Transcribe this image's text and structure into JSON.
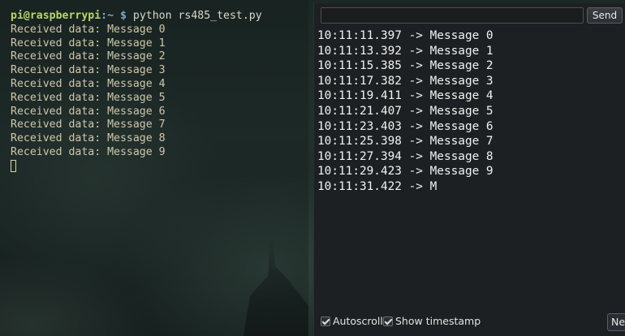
{
  "terminal": {
    "prompt_user": "pi@raspberrypi",
    "prompt_path": ":~ $",
    "command": "python rs485_test.py",
    "lines": [
      "Received data: Message 0",
      "Received data: Message 1",
      "Received data: Message 2",
      "Received data: Message 3",
      "Received data: Message 4",
      "Received data: Message 5",
      "Received data: Message 6",
      "Received data: Message 7",
      "Received data: Message 8",
      "Received data: Message 9"
    ]
  },
  "serial_monitor": {
    "input_value": "",
    "send_label": "Send",
    "output_lines": [
      "10:11:11.397 -> Message 0",
      "10:11:13.392 -> Message 1",
      "10:11:15.385 -> Message 2",
      "10:11:17.382 -> Message 3",
      "10:11:19.411 -> Message 4",
      "10:11:21.407 -> Message 5",
      "10:11:23.403 -> Message 6",
      "10:11:25.398 -> Message 7",
      "10:11:27.394 -> Message 8",
      "10:11:29.423 -> Message 9",
      "10:11:31.422 -> M"
    ],
    "autoscroll_label": "Autoscroll",
    "autoscroll_checked": true,
    "timestamp_label": "Show timestamp",
    "timestamp_checked": true,
    "line_ending_label": "Ne"
  },
  "colors": {
    "prompt_user": "#b8d66a",
    "prompt_path": "#7fa6c8",
    "terminal_text": "#cfc7aa",
    "monitor_background": "#1d2022"
  }
}
